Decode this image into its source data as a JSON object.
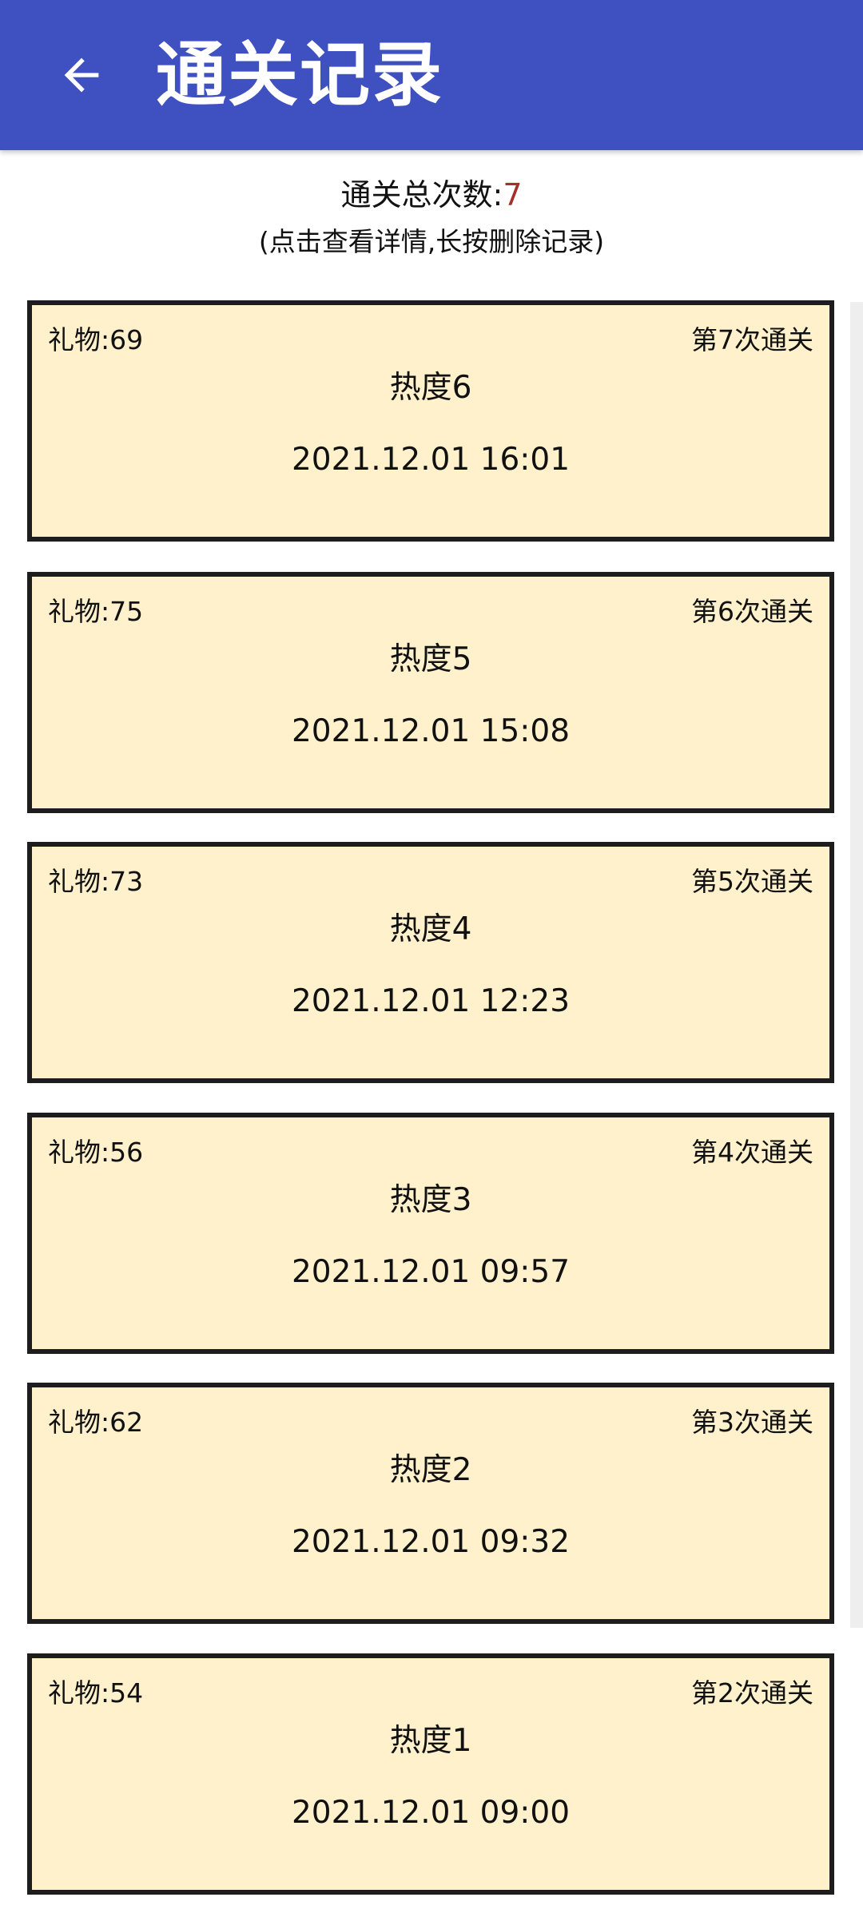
{
  "appbar": {
    "title": "通关记录",
    "back_icon": "arrow-left-icon"
  },
  "summary": {
    "label": "通关总次数:",
    "count": "7",
    "hint": "(点击查看详情,长按删除记录)"
  },
  "colors": {
    "appbar": "#3f51c1",
    "card_bg": "#fff1cc",
    "card_border": "#1d1d1d",
    "count_accent": "#a0322a"
  },
  "records": [
    {
      "gift": "礼物:69",
      "count": "第7次通关",
      "heat": "热度6",
      "time": "2021.12.01 16:01"
    },
    {
      "gift": "礼物:75",
      "count": "第6次通关",
      "heat": "热度5",
      "time": "2021.12.01 15:08"
    },
    {
      "gift": "礼物:73",
      "count": "第5次通关",
      "heat": "热度4",
      "time": "2021.12.01 12:23"
    },
    {
      "gift": "礼物:56",
      "count": "第4次通关",
      "heat": "热度3",
      "time": "2021.12.01 09:57"
    },
    {
      "gift": "礼物:62",
      "count": "第3次通关",
      "heat": "热度2",
      "time": "2021.12.01 09:32"
    },
    {
      "gift": "礼物:54",
      "count": "第2次通关",
      "heat": "热度1",
      "time": "2021.12.01 09:00"
    }
  ]
}
